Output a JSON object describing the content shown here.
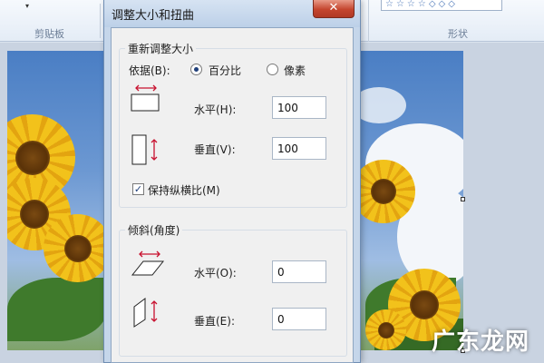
{
  "background": {
    "ribbon": {
      "clipboard_group_label": "剪贴板",
      "shapes_group_label": "形状",
      "dropdown_glyph": "▾",
      "shape_strip": "☆☆☆☆◇◇◇"
    },
    "watermark": "广东龙网"
  },
  "dialog": {
    "title": "调整大小和扭曲",
    "close_glyph": "✕",
    "resize": {
      "group_title": "重新调整大小",
      "by_label": "依据(B):",
      "options": [
        {
          "label": "百分比",
          "selected": true
        },
        {
          "label": "像素",
          "selected": false
        }
      ],
      "horizontal_label": "水平(H):",
      "horizontal_value": "100",
      "vertical_label": "垂直(V):",
      "vertical_value": "100",
      "keep_ratio_label": "保持纵横比(M)",
      "keep_ratio_checked": true,
      "check_glyph": "✓"
    },
    "skew": {
      "group_title": "倾斜(角度)",
      "horizontal_label": "水平(O):",
      "horizontal_value": "0",
      "vertical_label": "垂直(E):",
      "vertical_value": "0"
    }
  },
  "colors": {
    "arrow_red": "#c8102e",
    "close_red": "#c4452e"
  },
  "icons": {
    "resize_h": "resize-horizontal-icon",
    "resize_v": "resize-vertical-icon",
    "skew_h": "skew-horizontal-icon",
    "skew_v": "skew-vertical-icon"
  }
}
